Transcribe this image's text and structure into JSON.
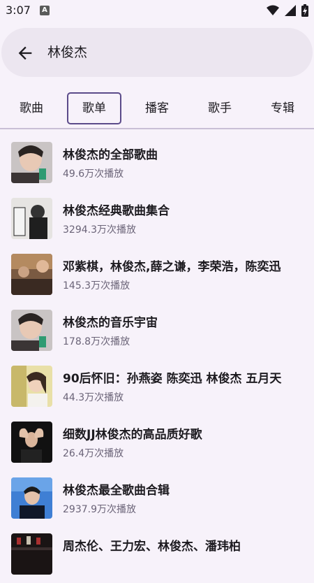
{
  "status": {
    "time": "3:07",
    "notif_letter": "A"
  },
  "search": {
    "query": "林俊杰"
  },
  "tabs": [
    {
      "label": "歌曲",
      "active": false
    },
    {
      "label": "歌单",
      "active": true
    },
    {
      "label": "播客",
      "active": false
    },
    {
      "label": "歌手",
      "active": false
    },
    {
      "label": "专辑",
      "active": false
    }
  ],
  "playlists": [
    {
      "title": "林俊杰的全部歌曲",
      "plays": "49.6万次播放",
      "cover": "jj-face"
    },
    {
      "title": "林俊杰经典歌曲集合",
      "plays": "3294.3万次播放",
      "cover": "jj-bw"
    },
    {
      "title": "邓紫棋，林俊杰,薛之谦，李荣浩，陈奕迅",
      "plays": "145.3万次播放",
      "cover": "group"
    },
    {
      "title": "林俊杰的音乐宇宙",
      "plays": "178.8万次播放",
      "cover": "jj-face"
    },
    {
      "title": "90后怀旧：孙燕姿 陈奕迅 林俊杰 五月天",
      "plays": "44.3万次播放",
      "cover": "woman"
    },
    {
      "title": "细数JJ林俊杰的高品质好歌",
      "plays": "26.4万次播放",
      "cover": "jj-heart"
    },
    {
      "title": "林俊杰最全歌曲合辑",
      "plays": "2937.9万次播放",
      "cover": "jj-blue"
    },
    {
      "title": "周杰伦、王力宏、林俊杰、潘玮柏",
      "plays": "",
      "cover": "dark-stage"
    }
  ],
  "colors": {
    "background": "#f7f2fa",
    "search_bg": "#ece6f0",
    "accent": "#5b4b8a",
    "secondary_text": "#6b6478"
  }
}
